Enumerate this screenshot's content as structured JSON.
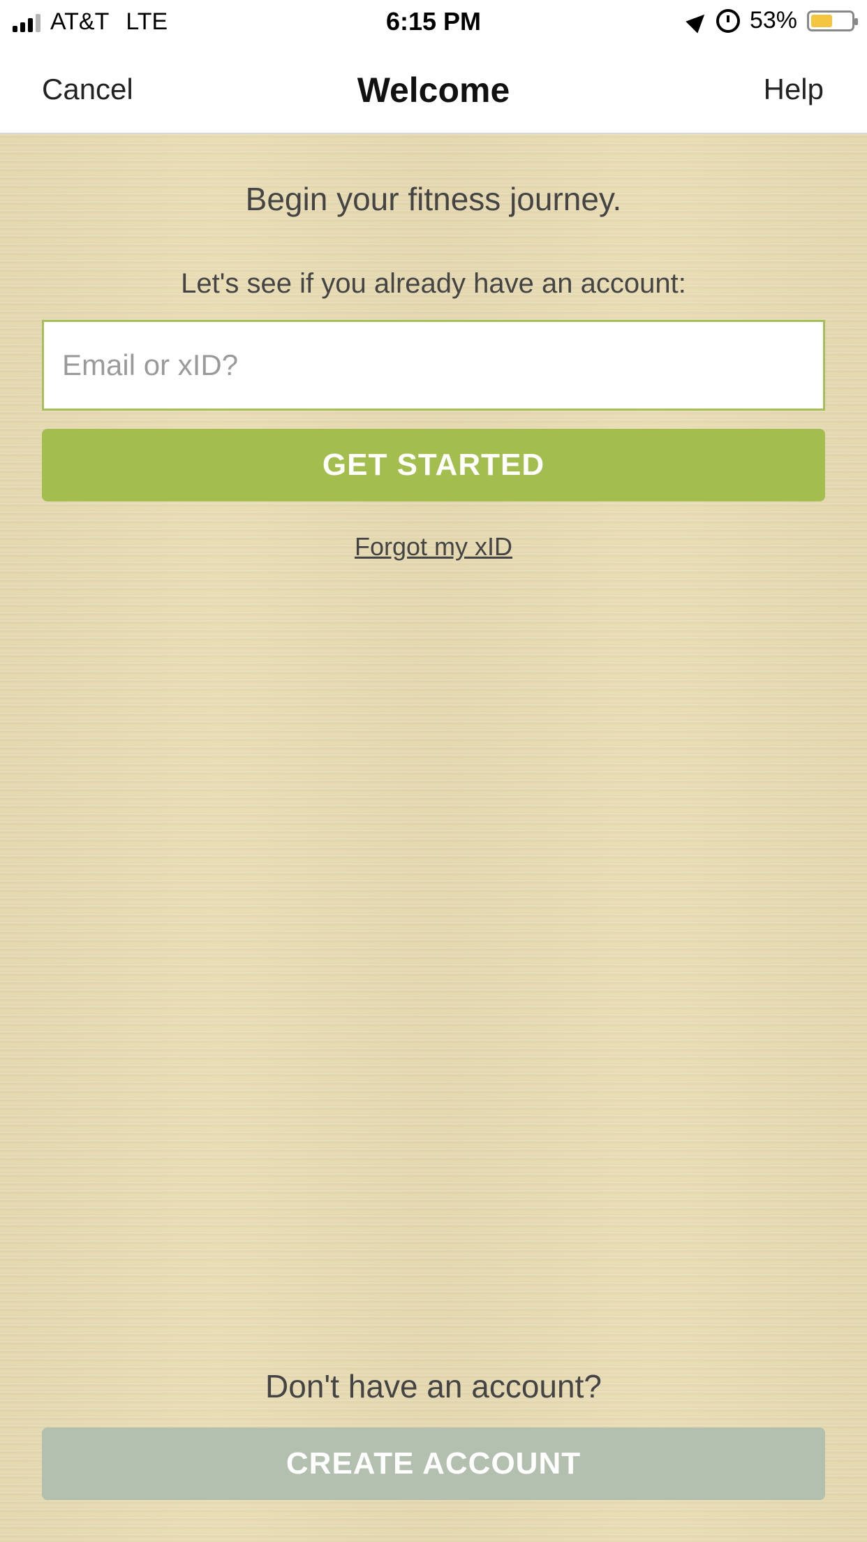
{
  "status_bar": {
    "carrier": "AT&T",
    "network": "LTE",
    "time": "6:15 PM",
    "battery_percent": "53%",
    "battery_level": 0.53,
    "icons": [
      "signal-icon",
      "location-icon",
      "alarm-icon",
      "battery-icon"
    ]
  },
  "nav": {
    "cancel_label": "Cancel",
    "title": "Welcome",
    "help_label": "Help"
  },
  "main": {
    "headline": "Begin your fitness journey.",
    "subline": "Let's see if you already have an account:",
    "email_placeholder": "Email or xID?",
    "get_started_label": "GET STARTED",
    "forgot_label": "Forgot my xID"
  },
  "footer": {
    "prompt": "Don't have an account?",
    "create_account_label": "CREATE ACCOUNT"
  },
  "colors": {
    "accent_green": "#a3bd4f",
    "input_border": "#a5c05b",
    "create_button": "#b3bfaf",
    "background": "#e9dcb3",
    "battery_fill": "#f3c540"
  }
}
